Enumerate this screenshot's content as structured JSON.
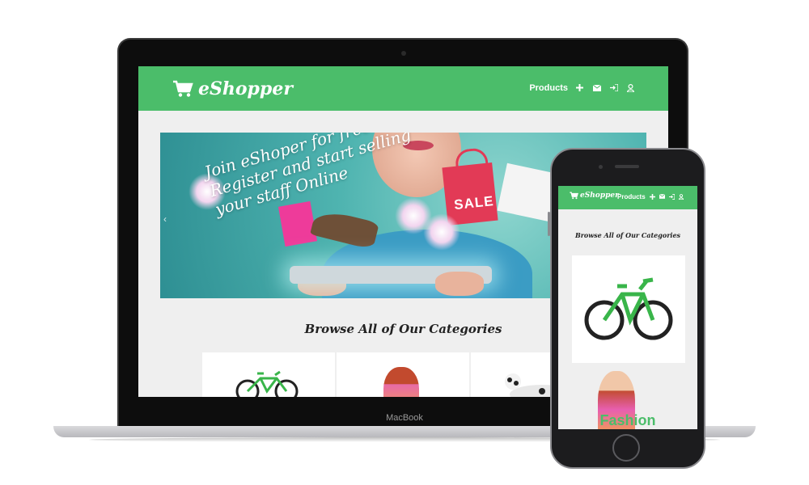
{
  "laptop": {
    "brand": "MacBook",
    "site": {
      "logo": "eShopper",
      "nav": {
        "products_label": "Products",
        "icons": [
          "plus-icon",
          "envelope-icon",
          "sign-in-icon",
          "user-icon"
        ]
      },
      "banner": {
        "line1": "Join eShoper for free",
        "line2": "Register and start selling",
        "line3": "your staff Online",
        "bag_label": "SALE"
      },
      "section_title": "Browse All of Our Categories",
      "categories": [
        "bike",
        "fashion",
        "pets"
      ]
    }
  },
  "phone": {
    "site": {
      "logo": "eShopper",
      "nav": {
        "products_label": "Products"
      },
      "section_title": "Browse All of Our Categories",
      "category_label": "Fashion"
    }
  },
  "colors": {
    "brand_green": "#4bbd6a",
    "page_bg": "#efefef",
    "device_dark": "#0d0d0d"
  }
}
